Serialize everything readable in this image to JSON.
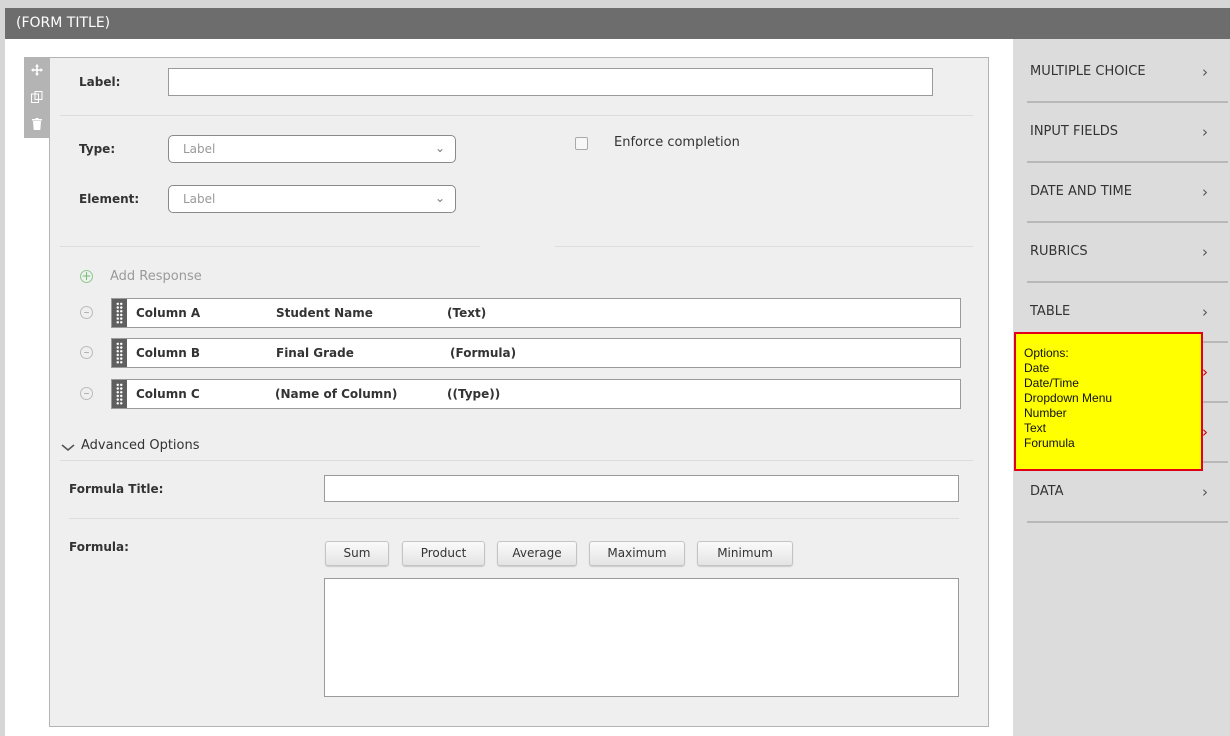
{
  "window": {
    "title": "(FORM TITLE)"
  },
  "editor": {
    "label_label": "Label:",
    "label_value": "",
    "type_label": "Type:",
    "type_value": "Label",
    "element_label": "Element:",
    "element_value": "Label",
    "enforce_label": "Enforce completion",
    "add_response_label": "Add Response",
    "columns": [
      {
        "name": "Column A",
        "title": "Student Name",
        "type": "(Text)"
      },
      {
        "name": "Column B",
        "title": "Final Grade",
        "type": "(Formula)"
      },
      {
        "name": "Column C",
        "title": "(Name of Column)",
        "type": "((Type))"
      }
    ],
    "advanced_options_label": "Advanced Options",
    "formula_title_label": "Formula Title:",
    "formula_title_value": "",
    "formula_label": "Formula:",
    "formula_buttons": [
      "Sum",
      "Product",
      "Average",
      "Maximum",
      "Minimum"
    ],
    "formula_value": ""
  },
  "sidebar": {
    "items": [
      {
        "label": "MULTIPLE CHOICE"
      },
      {
        "label": "INPUT FIELDS"
      },
      {
        "label": "DATE AND TIME"
      },
      {
        "label": "RUBRICS"
      },
      {
        "label": "TABLE"
      },
      {
        "label": ""
      },
      {
        "label": ""
      },
      {
        "label": "DATA"
      }
    ]
  },
  "tooltip": {
    "lines": [
      "Options:",
      "Date",
      "Date/Time",
      "Dropdown Menu",
      "Number",
      "Text",
      "Forumula"
    ]
  },
  "icons": {
    "move": "move-icon",
    "copy": "copy-icon",
    "delete": "trash-icon",
    "drag": "drag-handle-icon",
    "add": "plus-circle-icon",
    "remove": "minus-circle-icon",
    "expand": "chevron-down-icon",
    "nav": "chevron-right-icon"
  },
  "colors": {
    "title_bar": "#6d6d6d",
    "tooltip_bg": "#ffff00",
    "tooltip_border": "#e0001a",
    "add_icon": "#6cbf6c"
  }
}
